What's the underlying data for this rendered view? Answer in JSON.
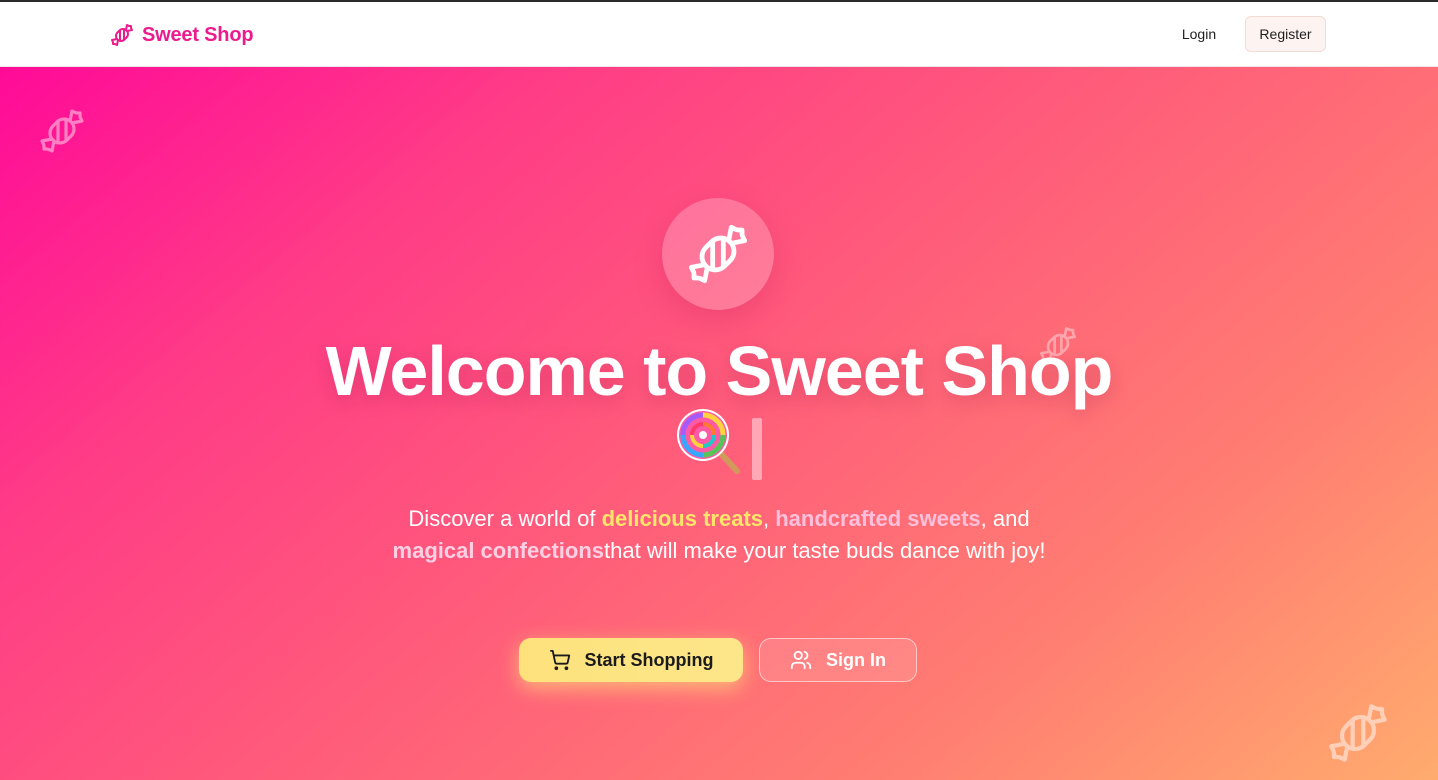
{
  "navbar": {
    "brand_name": "Sweet Shop",
    "brand_icon": "candy-icon",
    "login_label": "Login",
    "register_label": "Register"
  },
  "hero": {
    "title": "Welcome to Sweet Shop",
    "title_emoji": "lollipop-icon",
    "subtitle": {
      "part1": "Discover a world of ",
      "highlight1": "delicious treats",
      "part2": ", ",
      "highlight2": "handcrafted sweets",
      "part3": ", and ",
      "highlight3": "magical confections",
      "part4": "that will make your taste buds dance with joy!"
    },
    "primary_button": "Start Shopping",
    "secondary_button": "Sign In"
  },
  "colors": {
    "brand": "#ec1c8e",
    "gradient_start": "#ff0a98",
    "gradient_end": "#ffab6e",
    "primary_button": "#fde27c",
    "highlight_yellow": "#ffe66b",
    "highlight_pink": "#ffc0dc"
  },
  "icons": [
    "candy-icon",
    "lollipop-icon",
    "shopping-cart-icon",
    "users-icon"
  ]
}
